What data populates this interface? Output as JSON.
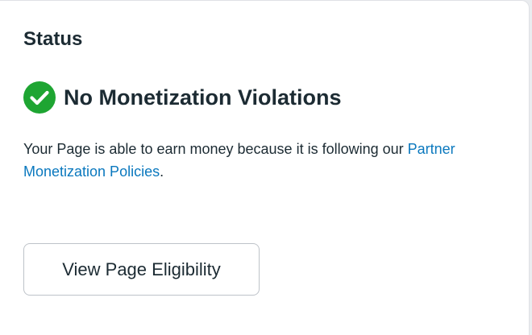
{
  "card": {
    "title": "Status",
    "status": {
      "icon": "check-circle-icon",
      "icon_color": "#1ea532",
      "heading": "No Monetization Violations"
    },
    "description": {
      "text": "Your Page is able to earn money because it is following our ",
      "link_text": "Partner Monetization Policies",
      "suffix": "."
    },
    "button_label": "View Page Eligibility"
  }
}
